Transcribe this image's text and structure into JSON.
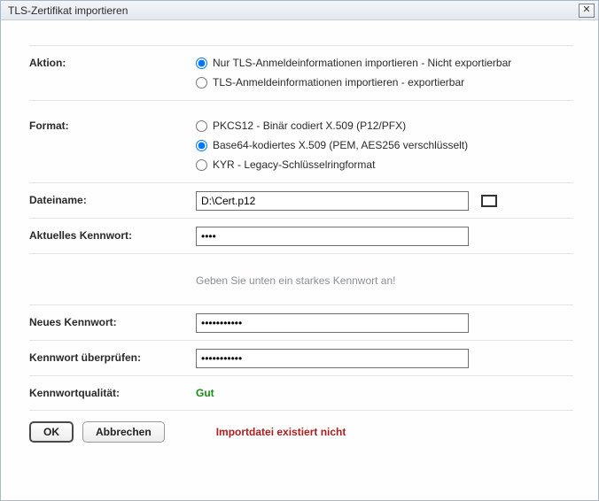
{
  "window": {
    "title": "TLS-Zertifikat importieren"
  },
  "aktion": {
    "label": "Aktion:",
    "options": [
      "Nur TLS-Anmeldeinformationen importieren - Nicht exportierbar",
      "TLS-Anmeldeinformationen importieren - exportierbar"
    ],
    "selected": 0
  },
  "format": {
    "label": "Format:",
    "options": [
      "PKCS12 - Binär codiert X.509 (P12/PFX)",
      "Base64-kodiertes X.509 (PEM, AES256 verschlüsselt)",
      "KYR - Legacy-Schlüsselringformat"
    ],
    "selected": 1
  },
  "dateiname": {
    "label": "Dateiname:",
    "value": "D:\\Cert.p12"
  },
  "aktuellesKennwort": {
    "label": "Aktuelles Kennwort:",
    "value": "••••"
  },
  "hint": "Geben Sie unten ein starkes Kennwort an!",
  "neuesKennwort": {
    "label": "Neues Kennwort:",
    "value": "•••••••••••"
  },
  "kennwortUeberpruefen": {
    "label": "Kennwort überprüfen:",
    "value": "•••••••••••"
  },
  "kennwortqualitaet": {
    "label": "Kennwortqualität:",
    "value": "Gut"
  },
  "error": "Importdatei existiert nicht",
  "buttons": {
    "ok": "OK",
    "cancel": "Abbrechen"
  }
}
